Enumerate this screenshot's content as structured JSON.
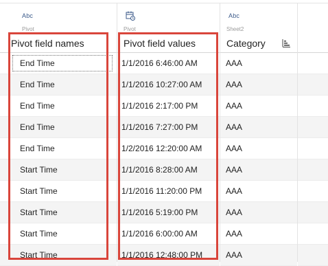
{
  "columns": [
    {
      "type_label": "Abc",
      "source": "Pivot",
      "name": "Pivot field names"
    },
    {
      "type_label": "",
      "type_icon": "date-time-icon",
      "source": "Pivot",
      "name": "Pivot field values"
    },
    {
      "type_label": "Abc",
      "source": "Sheet2",
      "name": "Category",
      "sort_icon": "sort-icon"
    }
  ],
  "rows": [
    {
      "name": "End Time",
      "value": "1/1/2016 6:46:00 AM",
      "category": "AAA"
    },
    {
      "name": "End Time",
      "value": "1/1/2016 10:27:00 AM",
      "category": "AAA"
    },
    {
      "name": "End Time",
      "value": "1/1/2016 2:17:00 PM",
      "category": "AAA"
    },
    {
      "name": "End Time",
      "value": "1/1/2016 7:27:00 PM",
      "category": "AAA"
    },
    {
      "name": "End Time",
      "value": "1/2/2016 12:20:00 AM",
      "category": "AAA"
    },
    {
      "name": "Start Time",
      "value": "1/1/2016 8:28:00 AM",
      "category": "AAA"
    },
    {
      "name": "Start Time",
      "value": "1/1/2016 11:20:00 PM",
      "category": "AAA"
    },
    {
      "name": "Start Time",
      "value": "1/1/2016 5:19:00 PM",
      "category": "AAA"
    },
    {
      "name": "Start Time",
      "value": "1/1/2016 6:00:00 AM",
      "category": "AAA"
    },
    {
      "name": "Start Time",
      "value": "1/1/2016 12:48:00 PM",
      "category": "AAA"
    }
  ],
  "colors": {
    "highlight": "#d9453b",
    "type_icon": "#3b5a8a"
  }
}
